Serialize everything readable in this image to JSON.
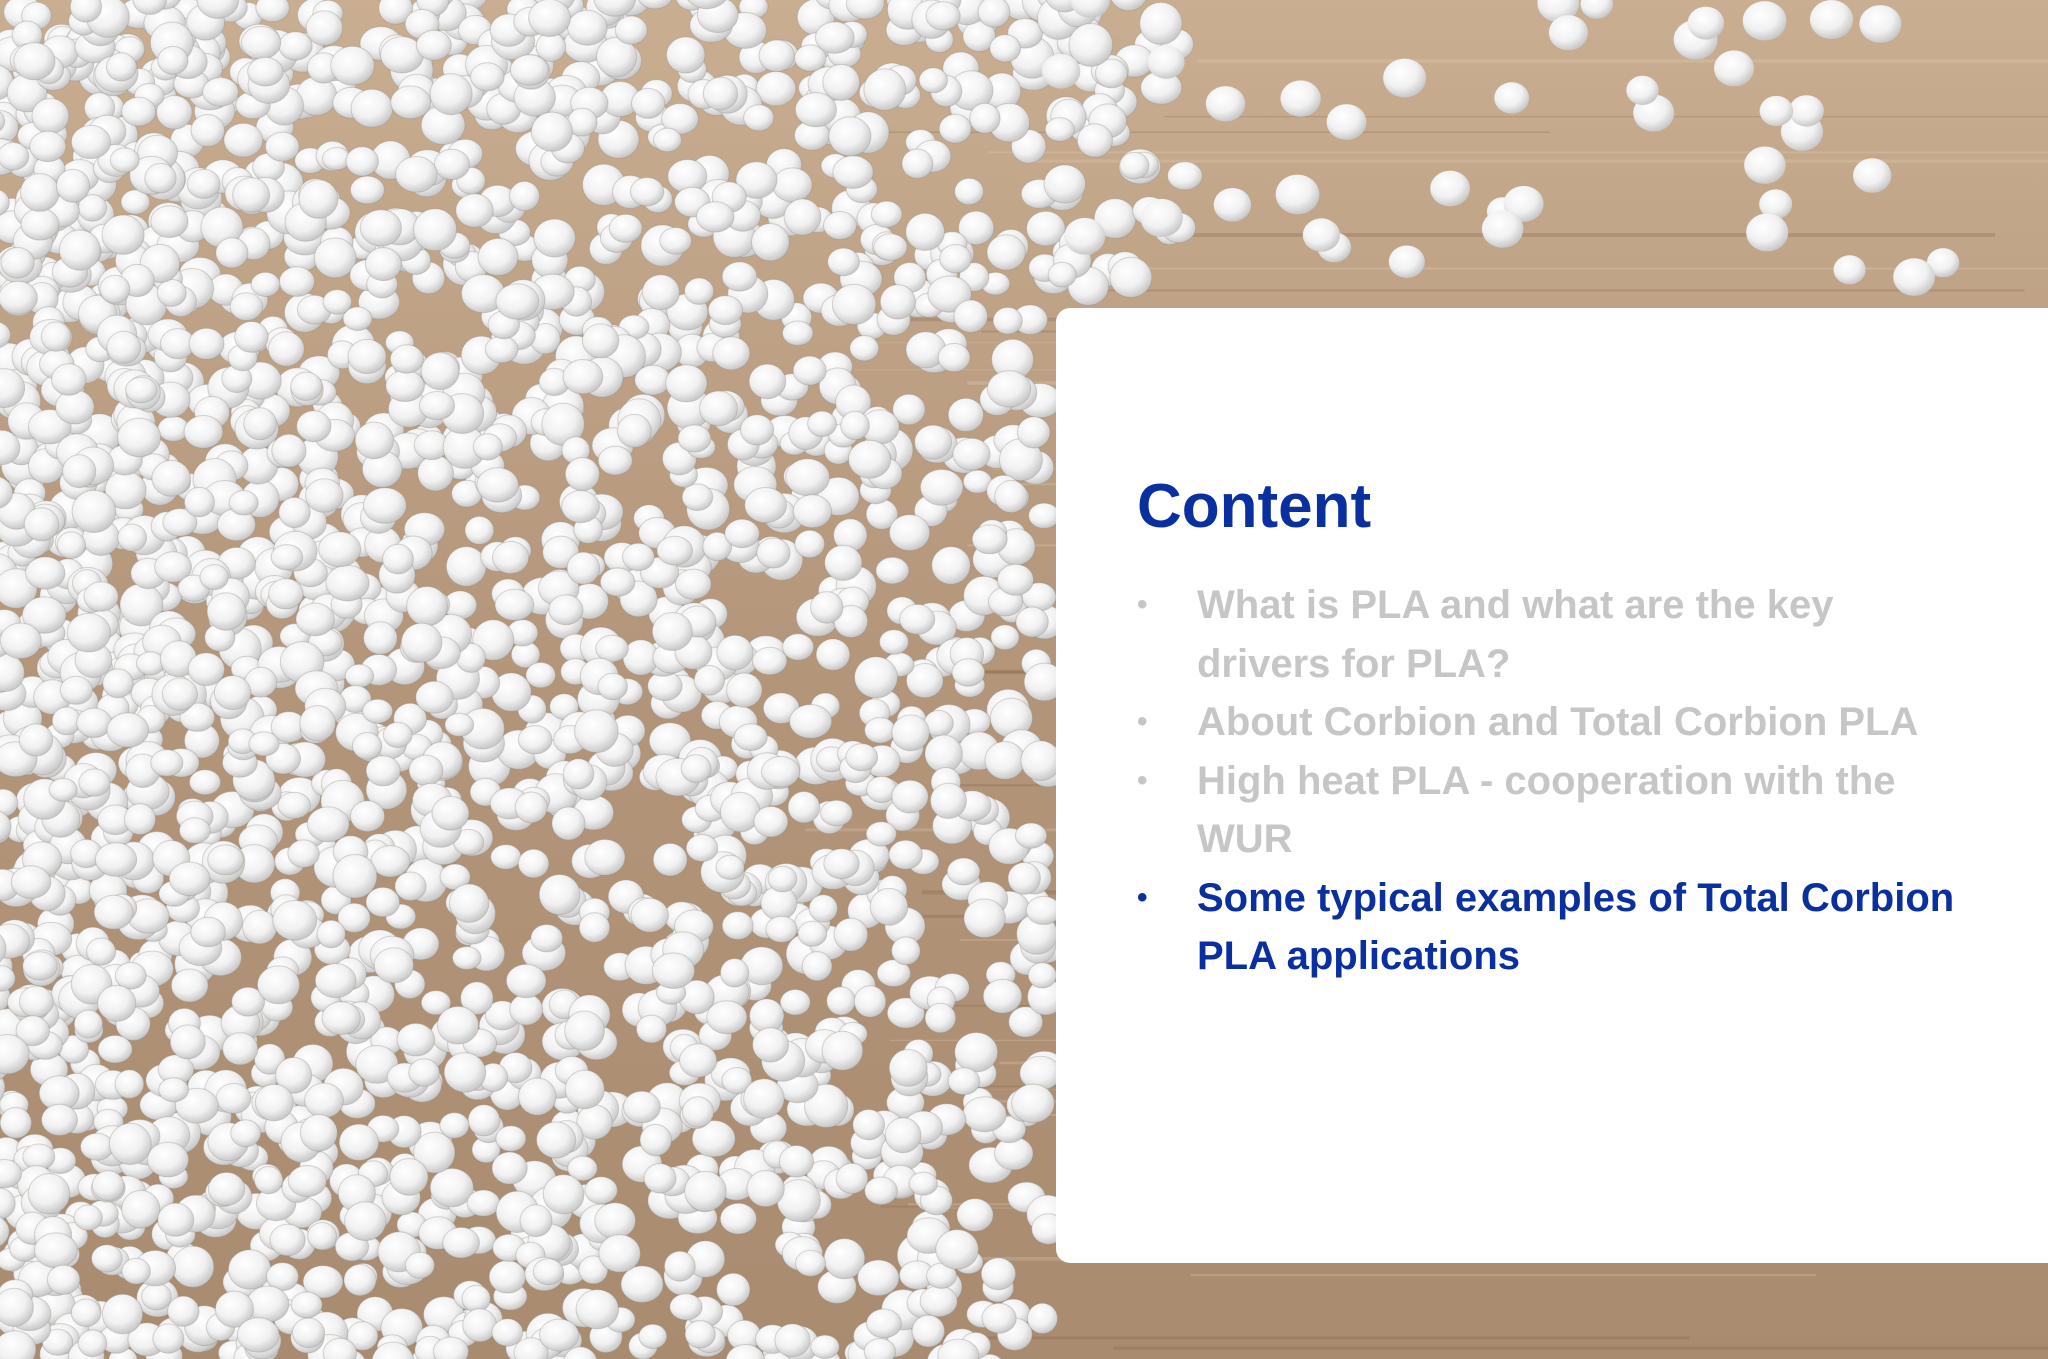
{
  "slide": {
    "title": "Content",
    "items": [
      {
        "text": "What is PLA and what are the key drivers for PLA?",
        "active": false
      },
      {
        "text": "About Corbion and Total Corbion PLA",
        "active": false
      },
      {
        "text": "High heat PLA - cooperation with the WUR",
        "active": false
      },
      {
        "text": "Some typical examples of Total Corbion PLA applications",
        "active": true
      }
    ]
  },
  "colors": {
    "accent": "#0a2f9e",
    "inactive_text": "#c6c6c6",
    "panel": "#ffffff",
    "wood": "#b89d80"
  },
  "background": {
    "icon": "pla-pellets-photo"
  }
}
